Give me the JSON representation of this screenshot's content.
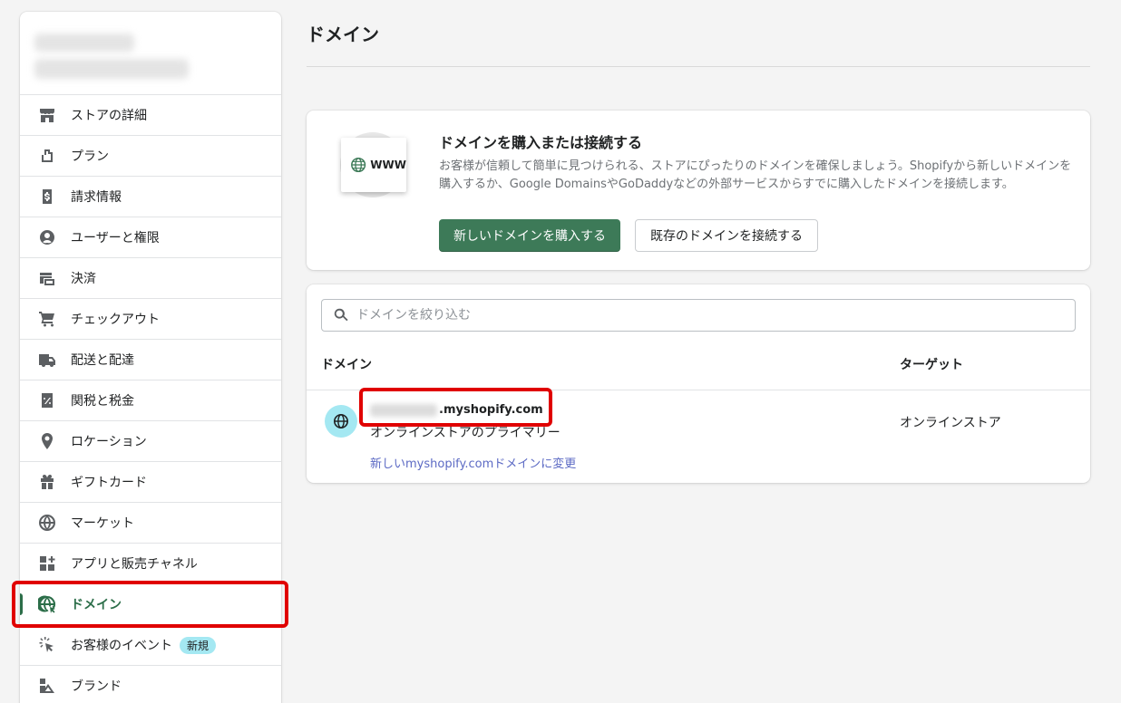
{
  "sidebar": {
    "items": [
      {
        "label": "ストアの詳細",
        "icon": "store-icon"
      },
      {
        "label": "プラン",
        "icon": "plan-icon"
      },
      {
        "label": "請求情報",
        "icon": "billing-icon"
      },
      {
        "label": "ユーザーと権限",
        "icon": "user-icon"
      },
      {
        "label": "決済",
        "icon": "payments-icon"
      },
      {
        "label": "チェックアウト",
        "icon": "cart-icon"
      },
      {
        "label": "配送と配達",
        "icon": "truck-icon"
      },
      {
        "label": "関税と税金",
        "icon": "tax-icon"
      },
      {
        "label": "ロケーション",
        "icon": "location-pin-icon"
      },
      {
        "label": "ギフトカード",
        "icon": "gift-icon"
      },
      {
        "label": "マーケット",
        "icon": "globe-icon"
      },
      {
        "label": "アプリと販売チャネル",
        "icon": "apps-icon"
      },
      {
        "label": "ドメイン",
        "icon": "domain-globe-icon",
        "active": true
      },
      {
        "label": "お客様のイベント",
        "icon": "cursor-click-icon",
        "badge": "新規"
      },
      {
        "label": "ブランド",
        "icon": "brand-icon"
      }
    ]
  },
  "page": {
    "title": "ドメイン"
  },
  "promo": {
    "title": "ドメインを購入または接続する",
    "description": "お客様が信頼して簡単に見つけられる、ストアにぴったりのドメインを確保しましょう。Shopifyから新しいドメインを購入するか、Google DomainsやGoDaddyなどの外部サービスからすでに購入したドメインを接続します。",
    "illustration_text": "WWW",
    "buy_button": "新しいドメインを購入する",
    "connect_button": "既存のドメインを接続する"
  },
  "domains": {
    "search_placeholder": "ドメインを絞り込む",
    "col_domain": "ドメイン",
    "col_target": "ターゲット",
    "rows": [
      {
        "domain_suffix": ".myshopify.com",
        "subtitle": "オンラインストアのプライマリー",
        "change_link": "新しいmyshopify.comドメインに変更",
        "target": "オンラインストア"
      }
    ]
  },
  "colors": {
    "primary_green": "#3d7a58",
    "active_green": "#2c6e49",
    "highlight_red": "#e00000",
    "link": "#5c6ac4",
    "badge_bg": "#a4e8f2"
  }
}
